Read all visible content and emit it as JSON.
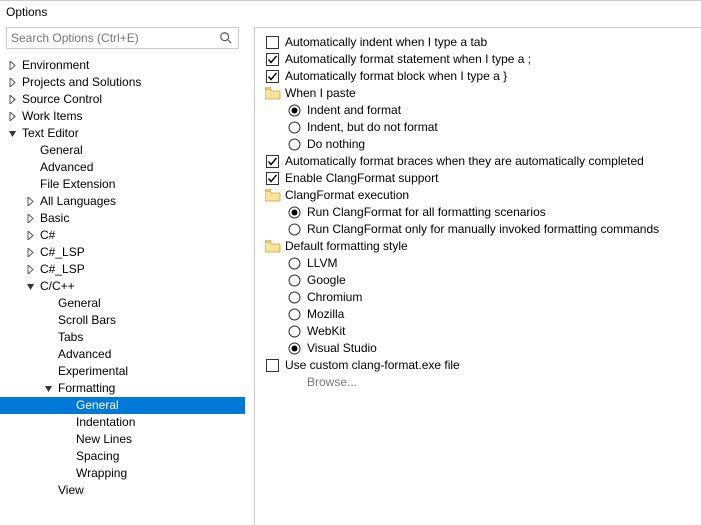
{
  "window": {
    "title": "Options"
  },
  "search": {
    "placeholder": "Search Options (Ctrl+E)"
  },
  "tree": [
    {
      "label": "Environment",
      "depth": 0,
      "expander": "closed"
    },
    {
      "label": "Projects and Solutions",
      "depth": 0,
      "expander": "closed"
    },
    {
      "label": "Source Control",
      "depth": 0,
      "expander": "closed"
    },
    {
      "label": "Work Items",
      "depth": 0,
      "expander": "closed"
    },
    {
      "label": "Text Editor",
      "depth": 0,
      "expander": "open"
    },
    {
      "label": "General",
      "depth": 1,
      "expander": "none"
    },
    {
      "label": "Advanced",
      "depth": 1,
      "expander": "none"
    },
    {
      "label": "File Extension",
      "depth": 1,
      "expander": "none"
    },
    {
      "label": "All Languages",
      "depth": 1,
      "expander": "closed"
    },
    {
      "label": "Basic",
      "depth": 1,
      "expander": "closed"
    },
    {
      "label": "C#",
      "depth": 1,
      "expander": "closed"
    },
    {
      "label": "C#_LSP",
      "depth": 1,
      "expander": "closed"
    },
    {
      "label": "C#_LSP",
      "depth": 1,
      "expander": "closed"
    },
    {
      "label": "C/C++",
      "depth": 1,
      "expander": "open"
    },
    {
      "label": "General",
      "depth": 2,
      "expander": "none"
    },
    {
      "label": "Scroll Bars",
      "depth": 2,
      "expander": "none"
    },
    {
      "label": "Tabs",
      "depth": 2,
      "expander": "none"
    },
    {
      "label": "Advanced",
      "depth": 2,
      "expander": "none"
    },
    {
      "label": "Experimental",
      "depth": 2,
      "expander": "none"
    },
    {
      "label": "Formatting",
      "depth": 2,
      "expander": "open"
    },
    {
      "label": "General",
      "depth": 3,
      "expander": "none",
      "selected": true
    },
    {
      "label": "Indentation",
      "depth": 3,
      "expander": "none"
    },
    {
      "label": "New Lines",
      "depth": 3,
      "expander": "none"
    },
    {
      "label": "Spacing",
      "depth": 3,
      "expander": "none"
    },
    {
      "label": "Wrapping",
      "depth": 3,
      "expander": "none"
    },
    {
      "label": "View",
      "depth": 2,
      "expander": "none"
    }
  ],
  "options": [
    {
      "kind": "checkbox",
      "checked": false,
      "indent": 0,
      "label": "Automatically indent when I type a tab"
    },
    {
      "kind": "checkbox",
      "checked": true,
      "indent": 0,
      "label": "Automatically format statement when I type a ;"
    },
    {
      "kind": "checkbox",
      "checked": true,
      "indent": 0,
      "label": "Automatically format block when I type a }"
    },
    {
      "kind": "folder",
      "indent": 0,
      "label": "When I paste"
    },
    {
      "kind": "radio",
      "checked": true,
      "indent": 1,
      "label": "Indent and format"
    },
    {
      "kind": "radio",
      "checked": false,
      "indent": 1,
      "label": "Indent, but do not format"
    },
    {
      "kind": "radio",
      "checked": false,
      "indent": 1,
      "label": "Do nothing"
    },
    {
      "kind": "checkbox",
      "checked": true,
      "indent": 0,
      "label": "Automatically format braces when they are automatically completed"
    },
    {
      "kind": "checkbox",
      "checked": true,
      "indent": 0,
      "label": "Enable ClangFormat support"
    },
    {
      "kind": "folder",
      "indent": 0,
      "label": "ClangFormat execution"
    },
    {
      "kind": "radio",
      "checked": true,
      "indent": 1,
      "label": "Run ClangFormat for all formatting scenarios"
    },
    {
      "kind": "radio",
      "checked": false,
      "indent": 1,
      "label": "Run ClangFormat only for manually invoked formatting commands"
    },
    {
      "kind": "folder",
      "indent": 0,
      "label": "Default formatting style"
    },
    {
      "kind": "radio",
      "checked": false,
      "indent": 1,
      "label": "LLVM"
    },
    {
      "kind": "radio",
      "checked": false,
      "indent": 1,
      "label": "Google"
    },
    {
      "kind": "radio",
      "checked": false,
      "indent": 1,
      "label": "Chromium"
    },
    {
      "kind": "radio",
      "checked": false,
      "indent": 1,
      "label": "Mozilla"
    },
    {
      "kind": "radio",
      "checked": false,
      "indent": 1,
      "label": "WebKit"
    },
    {
      "kind": "radio",
      "checked": true,
      "indent": 1,
      "label": "Visual Studio"
    },
    {
      "kind": "checkbox",
      "checked": false,
      "indent": 0,
      "label": "Use custom clang-format.exe file"
    },
    {
      "kind": "browse",
      "indent": 1,
      "label": "Browse..."
    }
  ]
}
